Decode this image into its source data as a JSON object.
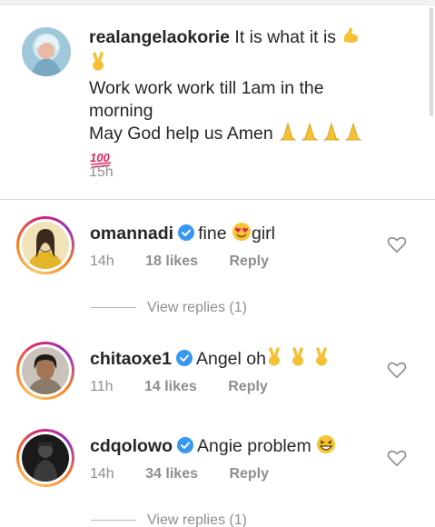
{
  "caption": {
    "username": "realangelaokorie",
    "line1": "It is what it is",
    "line2": "Work work work till 1am in the",
    "line3": "morning",
    "line4": "May God help us Amen",
    "time": "15h"
  },
  "comments": [
    {
      "username": "omannadi",
      "text": "fine",
      "text_after": "girl",
      "time": "14h",
      "likes": "18 likes",
      "reply": "Reply"
    },
    {
      "username": "chitaoxe1",
      "text": "Angel oh",
      "text_after": "",
      "time": "11h",
      "likes": "14 likes",
      "reply": "Reply"
    },
    {
      "username": "cdqolowo",
      "text": "Angie problem",
      "text_after": "",
      "time": "14h",
      "likes": "34 likes",
      "reply": "Reply"
    }
  ],
  "view_replies": [
    {
      "label": "View replies (1)"
    },
    {
      "label": "View replies (1)"
    }
  ],
  "colors": {
    "verified": "#3897f0",
    "muted": "#8e8e8e",
    "text": "#262626"
  },
  "icons": [
    "verified-badge-icon",
    "heart-icon",
    "flexed-biceps-emoji",
    "victory-hand-emoji",
    "folded-hands-emoji",
    "hundred-points-emoji",
    "smiling-face-heart-eyes-emoji",
    "grinning-squinting-face-emoji"
  ]
}
